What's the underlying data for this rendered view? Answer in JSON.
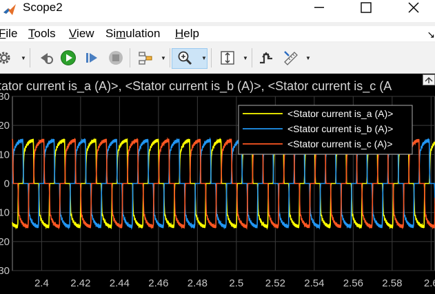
{
  "window": {
    "title": "Scope2"
  },
  "menu": {
    "items": [
      {
        "pre": "",
        "u": "F",
        "post": "ile"
      },
      {
        "pre": "",
        "u": "T",
        "post": "ools"
      },
      {
        "pre": "",
        "u": "V",
        "post": "iew"
      },
      {
        "pre": "Si",
        "u": "m",
        "post": "ulation"
      },
      {
        "pre": "",
        "u": "H",
        "post": "elp"
      }
    ]
  },
  "toolbar": {
    "icons": [
      "settings-icon",
      "step-back-icon",
      "run-icon",
      "step-forward-icon",
      "stop-icon",
      "highlight-signal-icon",
      "zoom-in-icon",
      "scale-axes-icon",
      "triggers-icon",
      "measurements-icon"
    ]
  },
  "plot": {
    "title": "tator current is_a (A)>, <Stator current is_b (A)>, <Stator current is_c (A"
  },
  "chart_data": {
    "type": "line",
    "title": "tator current is_a (A)>, <Stator current is_b (A)>, <Stator current is_c (A",
    "xlim": [
      2.385,
      2.602
    ],
    "ylim": [
      -30,
      30
    ],
    "xticks": [
      2.4,
      2.42,
      2.44,
      2.46,
      2.48,
      2.5,
      2.52,
      2.54,
      2.56,
      2.58,
      2.6
    ],
    "xtick_labels": [
      "2.4",
      "2.42",
      "2.44",
      "2.46",
      "2.48",
      "2.5",
      "2.52",
      "2.54",
      "2.56",
      "2.58",
      "2.6"
    ],
    "yticks": [
      -30,
      -20,
      -10,
      0,
      10,
      20,
      30
    ],
    "ytick_labels": [
      "30",
      "20",
      "10",
      "0",
      "10",
      "20",
      "30"
    ],
    "grid": true,
    "legend_position": "top-right",
    "background": "#000000",
    "series": [
      {
        "name": "<Stator current is_a (A)>",
        "color": "#ffff00",
        "period": 0.01605,
        "phase_start": 2.3905,
        "amplitude": 14.8
      },
      {
        "name": "<Stator current is_b (A)>",
        "color": "#2196f3",
        "period": 0.01605,
        "phase_start": 2.3851,
        "amplitude": 14.8
      },
      {
        "name": "<Stator current is_c (A)>",
        "color": "#ff5722",
        "period": 0.01605,
        "phase_start": 2.3959,
        "amplitude": 14.8
      }
    ]
  }
}
